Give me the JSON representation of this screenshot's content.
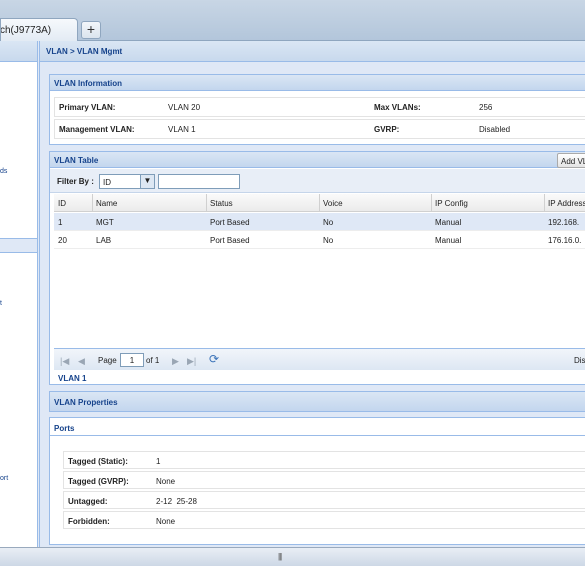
{
  "browser": {
    "tab_title": "ch(J9773A)",
    "new_tab_label": "+"
  },
  "leftnav": {
    "fragments": [
      "ds",
      "t",
      "ort"
    ]
  },
  "breadcrumb": "VLAN > VLAN Mgmt",
  "vlan_info": {
    "title": "VLAN Information",
    "rows": [
      {
        "label1": "Primary VLAN:",
        "value1": "VLAN 20",
        "label2": "Max VLANs:",
        "value2": "256"
      },
      {
        "label1": "Management VLAN:",
        "value1": "VLAN 1",
        "label2": "GVRP:",
        "value2": "Disabled"
      }
    ]
  },
  "vlan_table": {
    "title": "VLAN Table",
    "add_button": "Add VLA",
    "filter_label": "Filter By :",
    "filter_value": "ID",
    "filter_dropdown_icon": "▼",
    "filter_text": "",
    "columns": [
      "ID",
      "Name",
      "Status",
      "Voice",
      "IP Config",
      "IP Address"
    ],
    "rows": [
      {
        "id": "1",
        "name": "MGT",
        "status": "Port Based",
        "voice": "No",
        "ip_config": "Manual",
        "ip_address": "192.168."
      },
      {
        "id": "20",
        "name": "LAB",
        "status": "Port Based",
        "voice": "No",
        "ip_config": "Manual",
        "ip_address": "176.16.0."
      }
    ],
    "selected_row_index": 0,
    "pager": {
      "first_icon": "|◀",
      "prev_icon": "◀",
      "page_label": "Page",
      "page_value": "1",
      "of_label": "of 1",
      "next_icon": "▶",
      "last_icon": "▶|",
      "refresh_icon": "⟳",
      "display_text": "Dis"
    },
    "footer_title": "VLAN 1"
  },
  "vlan_properties": {
    "title": "VLAN Properties"
  },
  "ports": {
    "title": "Ports",
    "rows": [
      {
        "label": "Tagged (Static):",
        "value": "1"
      },
      {
        "label": "Tagged (GVRP):",
        "value": "None"
      },
      {
        "label": "Untagged:",
        "value": "2-12  25-28"
      },
      {
        "label": "Forbidden:",
        "value": "None"
      }
    ]
  },
  "statusbar": {
    "grip": "|||"
  },
  "colors": {
    "panel_header": "#15428b",
    "panel_border": "#99bbe8",
    "selected_row": "#dfe8f6"
  }
}
